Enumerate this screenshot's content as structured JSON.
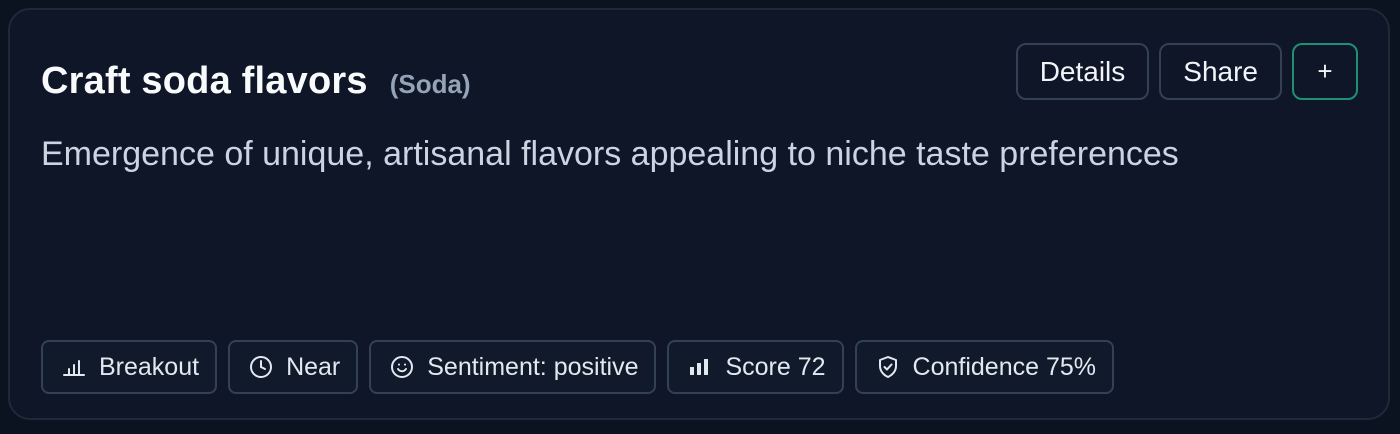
{
  "trend": {
    "title": "Craft soda flavors",
    "category": "(Soda)",
    "description": "Emergence of unique, artisanal flavors appealing to niche taste preferences"
  },
  "actions": {
    "details_label": "Details",
    "share_label": "Share",
    "add_label": "+"
  },
  "chips": {
    "stage": {
      "icon": "bar-chart-icon",
      "label": "Breakout"
    },
    "horizon": {
      "icon": "clock-icon",
      "label": "Near"
    },
    "sentiment": {
      "icon": "smile-icon",
      "label": "Sentiment: positive"
    },
    "score": {
      "icon": "signal-bars-icon",
      "label": "Score 72"
    },
    "confidence": {
      "icon": "shield-check-icon",
      "label": "Confidence 75%"
    }
  },
  "colors": {
    "background": "#0b1220",
    "card": "#0e1627",
    "border": "#334155",
    "accent_add_border": "#1f8f76",
    "title": "#f8fafc",
    "muted": "#94a3b8"
  }
}
